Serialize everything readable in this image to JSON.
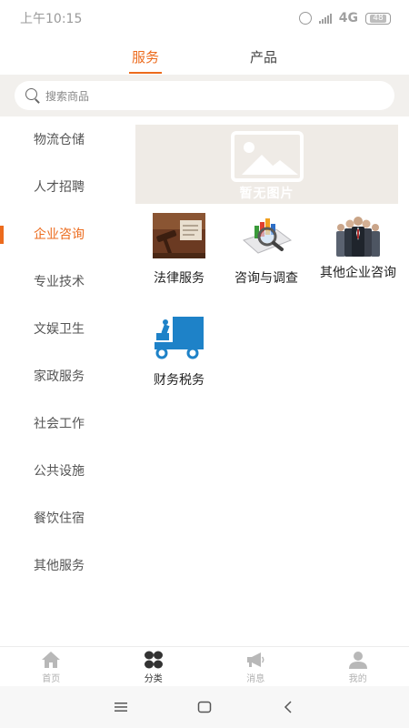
{
  "status_bar": {
    "time": "上午10:15",
    "network": "4G",
    "battery": "48"
  },
  "top_tabs": [
    {
      "label": "服务",
      "active": true
    },
    {
      "label": "产品",
      "active": false
    }
  ],
  "search": {
    "placeholder": "搜索商品"
  },
  "sidebar": {
    "active_index": 2,
    "items": [
      {
        "label": "物流仓储"
      },
      {
        "label": "人才招聘"
      },
      {
        "label": "企业咨询"
      },
      {
        "label": "专业技术"
      },
      {
        "label": "文娱卫生"
      },
      {
        "label": "家政服务"
      },
      {
        "label": "社会工作"
      },
      {
        "label": "公共设施"
      },
      {
        "label": "餐饮住宿"
      },
      {
        "label": "其他服务"
      }
    ]
  },
  "banner": {
    "text": "暂无图片"
  },
  "subcategories": [
    {
      "label": "法律服务",
      "icon": "law-gavel-image"
    },
    {
      "label": "咨询与调查",
      "icon": "magnifier-chart-image"
    },
    {
      "label": "其他企业咨询",
      "icon": "business-people-image"
    },
    {
      "label": "财务税务",
      "icon": "delivery-truck-image"
    }
  ],
  "bottom_nav": [
    {
      "label": "首页",
      "icon": "home-icon",
      "active": false
    },
    {
      "label": "分类",
      "icon": "category-icon",
      "active": true
    },
    {
      "label": "消息",
      "icon": "megaphone-icon",
      "active": false
    },
    {
      "label": "我的",
      "icon": "user-icon",
      "active": false
    }
  ],
  "colors": {
    "accent": "#ec6b1d",
    "search_bg": "#f2f0ed",
    "banner_bg": "#efebe6"
  }
}
